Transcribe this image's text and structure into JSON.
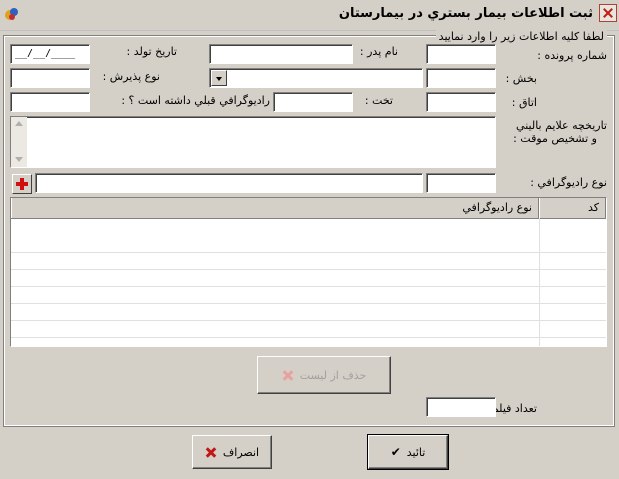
{
  "window": {
    "title": "ثبت اطلاعات بيمار بستري در بيمارستان"
  },
  "group": {
    "caption": "لطفا كليه اطلاعات زير را وارد نماييد"
  },
  "labels": {
    "file_number": "شماره پرونده :",
    "father_name": "نام پدر :",
    "birth_date": "تاريخ تولد :",
    "ward": "بخش :",
    "admission_type": "نوع پذيرش :",
    "room": "اتاق :",
    "bed": "تخت :",
    "prev_radiology": "راديوگرافي قبلي داشته است ؟ :",
    "history_line1": "تاريخچه علايم باليني",
    "history_line2": "و تشخيص موقت :",
    "radiology_type": "نوع راديوگرافي :",
    "film_count": "تعداد فيلم :"
  },
  "fields": {
    "birth_date_mask": "__/__/____",
    "file_number": "",
    "father_name": "",
    "ward": "",
    "admission_type": "",
    "room": "",
    "bed": "",
    "prev_radiology": "",
    "history": "",
    "radiology_code": "",
    "radiology_type": "",
    "film_count": ""
  },
  "grid": {
    "columns": [
      "كد",
      "نوع راديوگرافي"
    ],
    "rows": []
  },
  "buttons": {
    "remove_from_list": "حذف از ليست",
    "confirm": "تائيد",
    "cancel": "انصراف"
  },
  "icons": {
    "app": "app-icon",
    "close": "close-icon",
    "add": "plus-icon",
    "remove": "x-icon",
    "confirm": "check-icon",
    "cancel": "x-icon"
  },
  "colors": {
    "window_bg": "#d4d0c8",
    "accent_red": "#c01818"
  }
}
